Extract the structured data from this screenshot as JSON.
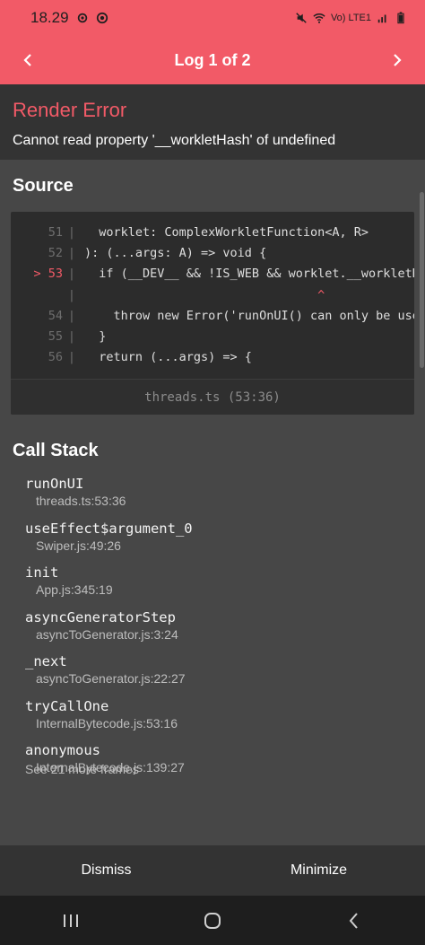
{
  "status_bar": {
    "time": "18.29",
    "network_label": "Vo) LTE1"
  },
  "header": {
    "title": "Log 1 of 2"
  },
  "error": {
    "title": "Render Error",
    "message": "Cannot read property '__workletHash' of undefined"
  },
  "source": {
    "title": "Source",
    "lines": [
      {
        "num": "51",
        "text": "  worklet: ComplexWorkletFunction<A, R>",
        "highlight": false
      },
      {
        "num": "52",
        "text": "): (...args: A) => void {",
        "highlight": false
      },
      {
        "num": "> 53",
        "text": "  if (__DEV__ && !IS_WEB && worklet.__workletH",
        "highlight": true
      },
      {
        "num": "",
        "text": "                                ^",
        "highlight": false
      },
      {
        "num": "54",
        "text": "    throw new Error('runOnUI() can only be use",
        "highlight": false
      },
      {
        "num": "55",
        "text": "  }",
        "highlight": false
      },
      {
        "num": "56",
        "text": "  return (...args) => {",
        "highlight": false
      }
    ],
    "file_location": "threads.ts (53:36)"
  },
  "call_stack": {
    "title": "Call Stack",
    "frames": [
      {
        "name": "runOnUI",
        "location": "threads.ts:53:36"
      },
      {
        "name": "useEffect$argument_0",
        "location": "Swiper.js:49:26"
      },
      {
        "name": "init",
        "location": "App.js:345:19"
      },
      {
        "name": "asyncGeneratorStep",
        "location": "asyncToGenerator.js:3:24"
      },
      {
        "name": "_next",
        "location": "asyncToGenerator.js:22:27"
      },
      {
        "name": "tryCallOne",
        "location": "InternalBytecode.js:53:16"
      },
      {
        "name": "anonymous",
        "location": "InternalBytecode.js:139:27"
      }
    ],
    "more_frames": "See 21 more frames"
  },
  "footer": {
    "dismiss_label": "Dismiss",
    "minimize_label": "Minimize"
  },
  "colors": {
    "accent": "#f25a67",
    "background": "#474747",
    "panel": "#333333",
    "code_bg": "#2c2c2c"
  }
}
